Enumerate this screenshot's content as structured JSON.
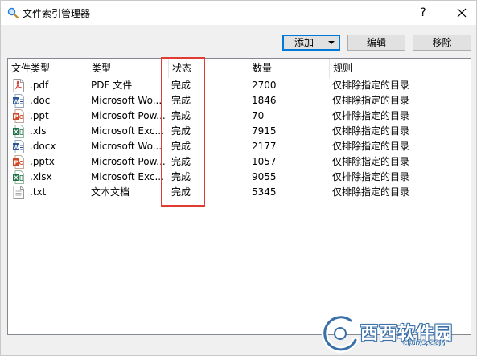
{
  "window": {
    "title": "文件索引管理器",
    "help_label": "?",
    "close_icon": "close-icon",
    "app_icon": "search-icon"
  },
  "toolbar": {
    "add_label": "添加",
    "edit_label": "编辑",
    "remove_label": "移除"
  },
  "list": {
    "columns": [
      "文件类型",
      "类型",
      "状态",
      "数量",
      "规则"
    ],
    "rows": [
      {
        "ext": ".pdf",
        "icon": "pdf-file-icon",
        "type": "PDF 文件",
        "status": "完成",
        "count": "2700",
        "rule": "仅排除指定的目录"
      },
      {
        "ext": ".doc",
        "icon": "word-file-icon",
        "type": "Microsoft Wo...",
        "status": "完成",
        "count": "1846",
        "rule": "仅排除指定的目录"
      },
      {
        "ext": ".ppt",
        "icon": "powerpoint-file-icon",
        "type": "Microsoft Pow...",
        "status": "完成",
        "count": "70",
        "rule": "仅排除指定的目录"
      },
      {
        "ext": ".xls",
        "icon": "excel-file-icon",
        "type": "Microsoft Exc...",
        "status": "完成",
        "count": "7915",
        "rule": "仅排除指定的目录"
      },
      {
        "ext": ".docx",
        "icon": "word-file-icon",
        "type": "Microsoft Wo...",
        "status": "完成",
        "count": "2177",
        "rule": "仅排除指定的目录"
      },
      {
        "ext": ".pptx",
        "icon": "powerpoint-file-icon",
        "type": "Microsoft Pow...",
        "status": "完成",
        "count": "1057",
        "rule": "仅排除指定的目录"
      },
      {
        "ext": ".xlsx",
        "icon": "excel-file-icon",
        "type": "Microsoft Exc...",
        "status": "完成",
        "count": "9055",
        "rule": "仅排除指定的目录"
      },
      {
        "ext": ".txt",
        "icon": "text-file-icon",
        "type": "文本文档",
        "status": "完成",
        "count": "5345",
        "rule": "仅排除指定的目录"
      }
    ]
  },
  "watermark": {
    "text": "西西软件园",
    "url": "CR173.COM"
  },
  "colors": {
    "highlight": "#e03c31",
    "pdf": "#d9342b",
    "word": "#2b579a",
    "powerpoint": "#d24726",
    "excel": "#217346",
    "accent": "#0078d7"
  }
}
